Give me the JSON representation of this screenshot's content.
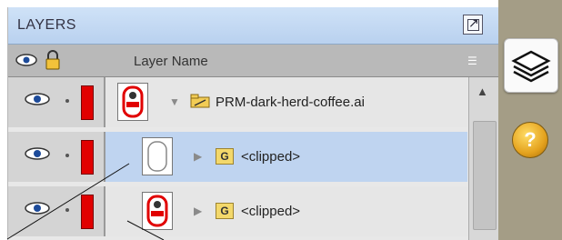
{
  "panel": {
    "title": "LAYERS",
    "columns": {
      "name_label": "Layer Name"
    },
    "rows": [
      {
        "name": "PRM-dark-herd-coffee.ai",
        "type": "document-folder",
        "expanded": true,
        "color": "#e10000",
        "selected": false
      },
      {
        "name": "<clipped>",
        "type": "group",
        "expanded": false,
        "color": "#e10000",
        "selected": true
      },
      {
        "name": "<clipped>",
        "type": "group",
        "expanded": false,
        "color": "#e10000",
        "selected": false
      }
    ]
  },
  "dock": {
    "tabs": [
      "layers-icon",
      "help-icon"
    ]
  },
  "colors": {
    "header": "#cfe2f7",
    "selected_row": "#bfd4f0",
    "layer_color": "#e10000",
    "dock": "#a49d86"
  }
}
